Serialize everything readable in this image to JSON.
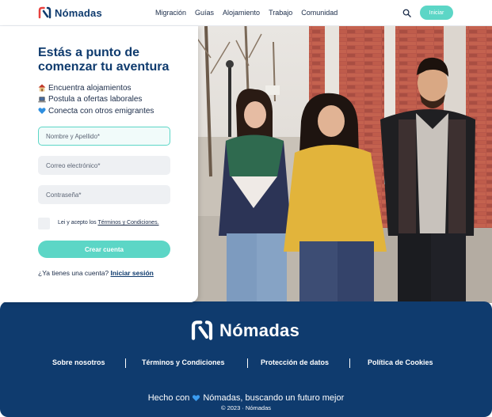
{
  "header": {
    "brand": "Nómadas",
    "nav": [
      "Migración",
      "Guías",
      "Alojamiento",
      "Trabajo",
      "Comunidad"
    ],
    "login_label": "Iniciar"
  },
  "form": {
    "title_line1": "Estás a punto de",
    "title_line2": "comenzar tu aventura",
    "features": [
      {
        "icon": "house-icon",
        "text": "Encuentra alojamientos"
      },
      {
        "icon": "laptop-icon",
        "text": "Postula a ofertas laborales"
      },
      {
        "icon": "blue-heart-icon",
        "text": "Conecta con otros emigrantes"
      }
    ],
    "name_placeholder": "Nombre y Apellido*",
    "email_placeholder": "Correo electrónico*",
    "password_placeholder": "Contraseña*",
    "terms_prefix": "Lei y acepto los",
    "terms_link": "Términos y Condiciones.",
    "submit_label": "Crear cuenta",
    "have_account": "¿Ya tienes una cuenta?",
    "login_link": "Iniciar sesión"
  },
  "footer": {
    "brand": "Nómadas",
    "links": [
      "Sobre nosotros",
      "Términos y Condiciones",
      "Protección de datos",
      "Política de Cookies"
    ],
    "tagline_prefix": "Hecho con",
    "tagline_suffix": "Nómadas, buscando un futuro mejor",
    "copyright": "© 2023 · Nómadas"
  },
  "colors": {
    "brand_navy": "#0f3b6e",
    "accent_teal": "#5cd6c6",
    "logo_red": "#e8423f"
  }
}
